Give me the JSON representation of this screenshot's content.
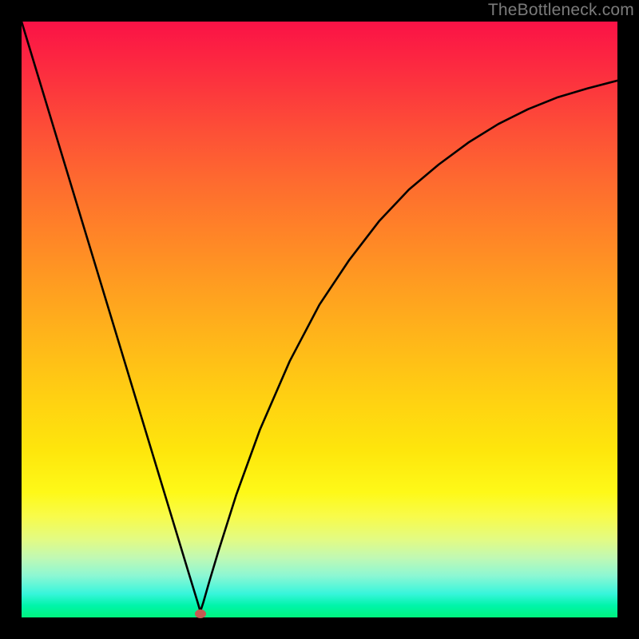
{
  "watermark": "TheBottleneck.com",
  "chart_data": {
    "type": "line",
    "title": "",
    "xlabel": "",
    "ylabel": "",
    "xlim": [
      0,
      1
    ],
    "ylim": [
      0,
      1
    ],
    "background_gradient": {
      "top_color": "#fb1246",
      "bottom_color": "#00f37e",
      "description": "vertical gradient red→orange→yellow→green, green zone at bottom indicates optimal region"
    },
    "series": [
      {
        "name": "bottleneck-curve",
        "description": "V-shaped curve: steep linear descent on left, minimum near x≈0.30, asymptotic rise on right",
        "x": [
          0.0,
          0.05,
          0.1,
          0.15,
          0.2,
          0.25,
          0.28,
          0.295,
          0.3,
          0.305,
          0.315,
          0.33,
          0.36,
          0.4,
          0.45,
          0.5,
          0.55,
          0.6,
          0.65,
          0.7,
          0.75,
          0.8,
          0.85,
          0.9,
          0.95,
          1.0
        ],
        "values": [
          1.0,
          0.835,
          0.67,
          0.505,
          0.34,
          0.175,
          0.076,
          0.027,
          0.01,
          0.025,
          0.06,
          0.11,
          0.205,
          0.315,
          0.43,
          0.525,
          0.6,
          0.665,
          0.718,
          0.76,
          0.797,
          0.828,
          0.853,
          0.873,
          0.888,
          0.901
        ]
      }
    ],
    "marker": {
      "name": "optimal-point",
      "x": 0.3,
      "y": 0.007,
      "color": "#c65a52"
    }
  }
}
